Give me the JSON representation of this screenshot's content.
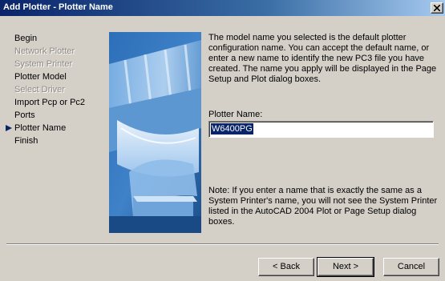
{
  "window": {
    "title": "Add Plotter - Plotter Name",
    "close_glyph": "✕"
  },
  "steps": [
    {
      "label": "Begin",
      "state": "normal"
    },
    {
      "label": "Network Plotter",
      "state": "disabled"
    },
    {
      "label": "System Printer",
      "state": "disabled"
    },
    {
      "label": "Plotter Model",
      "state": "normal"
    },
    {
      "label": "Select Driver",
      "state": "disabled"
    },
    {
      "label": "Import Pcp or Pc2",
      "state": "normal"
    },
    {
      "label": "Ports",
      "state": "normal"
    },
    {
      "label": "Plotter Name",
      "state": "current"
    },
    {
      "label": "Finish",
      "state": "normal"
    }
  ],
  "main": {
    "description": "The model name you selected is the default plotter configuration name. You can accept the default name, or enter a new name to identify the new PC3 file you have created. The name you apply will be displayed in the Page Setup and Plot dialog boxes.",
    "name_label": "Plotter Name:",
    "name_value": "W6400PG",
    "note": "Note: If you enter a name that is exactly the same as a System Printer's name, you will not see the System Printer listed in the AutoCAD 2004 Plot or Page Setup dialog boxes."
  },
  "buttons": {
    "back": "< Back",
    "next": "Next >",
    "cancel": "Cancel"
  },
  "colors": {
    "titlebar_start": "#0a246a",
    "titlebar_end": "#a6caf0",
    "selection": "#0a246a",
    "dialog_bg": "#d4d0c8"
  }
}
